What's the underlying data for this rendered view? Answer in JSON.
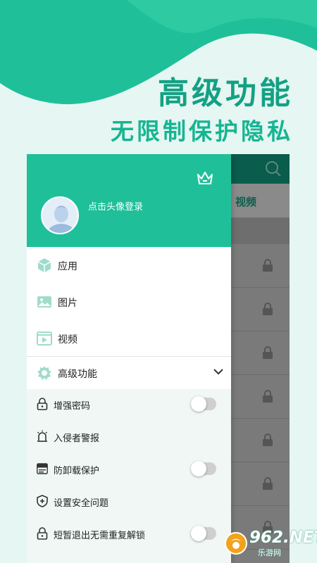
{
  "promo": {
    "title": "高级功能",
    "subtitle": "无限制保护隐私"
  },
  "background_app": {
    "tab_label": "视频",
    "search_icon": "search-icon",
    "row_icon": "lock-icon"
  },
  "drawer": {
    "header": {
      "login_text": "点击头像登录",
      "crown_icon": "crown-icon"
    },
    "nav_items": [
      {
        "label": "应用",
        "icon": "app-cube-icon"
      },
      {
        "label": "图片",
        "icon": "image-icon"
      },
      {
        "label": "视频",
        "icon": "video-icon"
      }
    ],
    "advanced": {
      "label": "高级功能",
      "expanded": true,
      "items": [
        {
          "label": "增强密码",
          "icon": "lock-icon",
          "toggle": false
        },
        {
          "label": "入侵者警报",
          "icon": "alarm-icon"
        },
        {
          "label": "防卸载保护",
          "icon": "apk-icon",
          "toggle": false
        },
        {
          "label": "设置安全问题",
          "icon": "shield-icon"
        },
        {
          "label": "短暂退出无需重复解锁",
          "icon": "lock-icon",
          "toggle": false
        }
      ]
    }
  },
  "watermark": {
    "brand": "962.NET",
    "sub": "乐游网"
  },
  "colors": {
    "accent": "#1fc099",
    "promo_text": "#13a184",
    "page_bg": "#e6f6f2",
    "dark_bar": "#0a5c4c"
  }
}
